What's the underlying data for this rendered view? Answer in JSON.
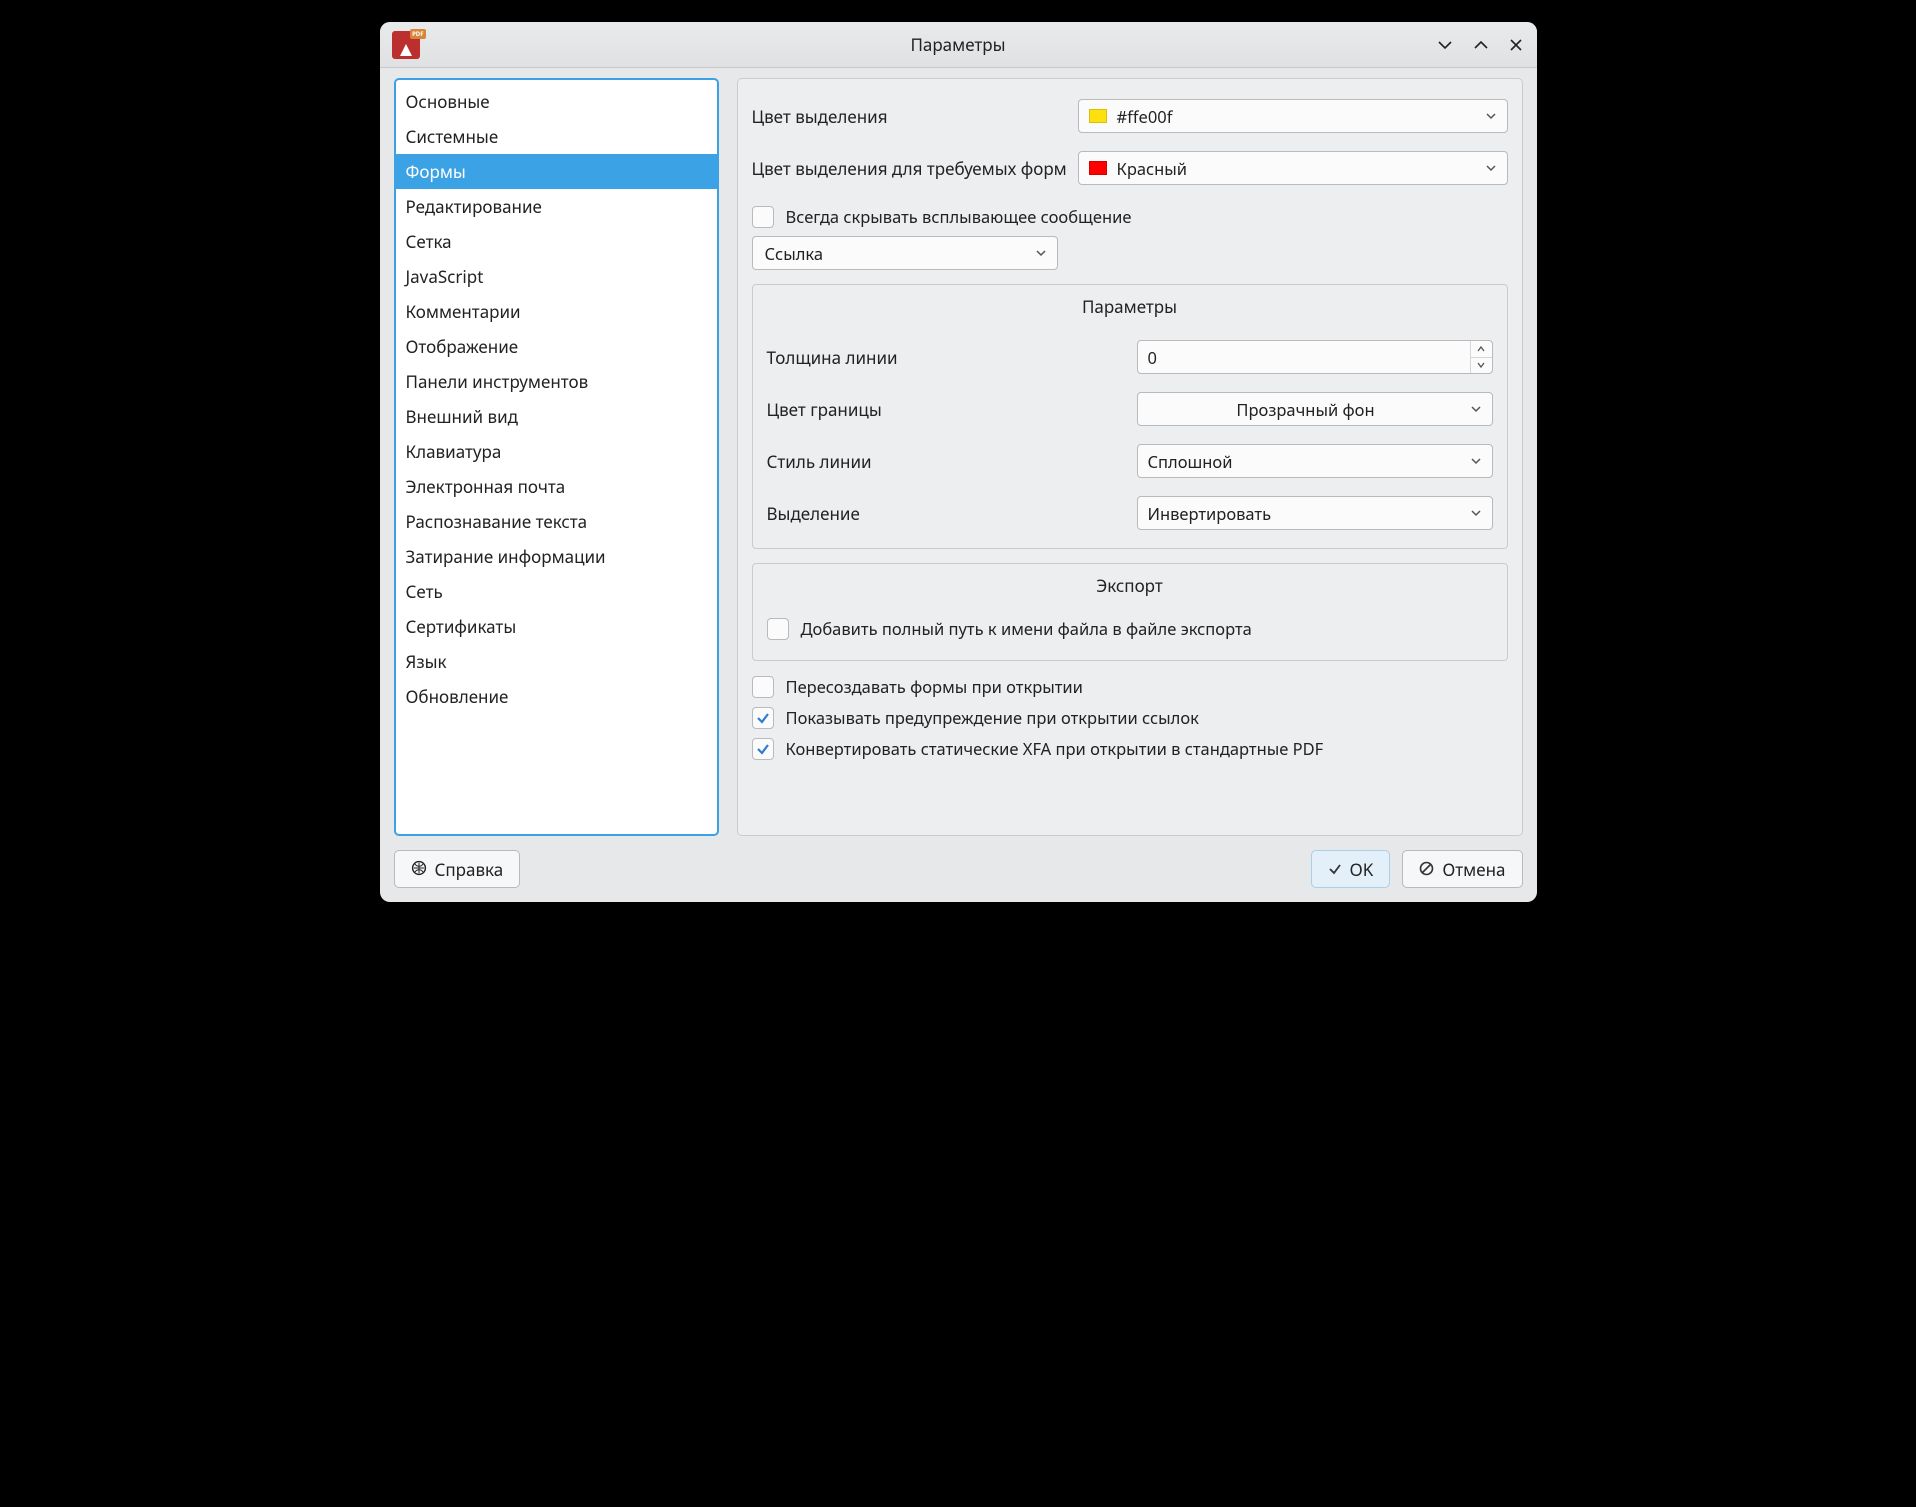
{
  "window": {
    "title": "Параметры"
  },
  "sidebar": {
    "items": [
      "Основные",
      "Системные",
      "Формы",
      "Редактирование",
      "Сетка",
      "JavaScript",
      "Комментарии",
      "Отображение",
      "Панели инструментов",
      "Внешний вид",
      "Клавиатура",
      "Электронная почта",
      "Распознавание текста",
      "Затирание информации",
      "Сеть",
      "Сертификаты",
      "Язык",
      "Обновление"
    ],
    "selected_index": 2
  },
  "form": {
    "highlight_color_label": "Цвет выделения",
    "highlight_color_value": "#ffe00f",
    "highlight_color_swatch": "#ffe00f",
    "required_highlight_label": "Цвет выделения для требуемых форм",
    "required_highlight_value": "Красный",
    "required_highlight_swatch": "#ff0000",
    "always_hide_popup": "Всегда скрывать всплывающее сообщение",
    "link_combo": "Ссылка",
    "params_group_title": "Параметры",
    "line_width_label": "Толщина линии",
    "line_width_value": "0",
    "border_color_label": "Цвет границы",
    "border_color_value": "Прозрачный фон",
    "line_style_label": "Стиль линии",
    "line_style_value": "Сплошной",
    "highlight_mode_label": "Выделение",
    "highlight_mode_value": "Инвертировать",
    "export_group_title": "Экспорт",
    "export_fullpath": "Добавить полный путь к имени файла в файле экспорта",
    "recreate_on_open": "Пересоздавать формы при открытии",
    "warn_on_links": "Показывать предупреждение при открытии ссылок",
    "convert_xfa": "Конвертировать статические XFA при открытии в стандартные PDF"
  },
  "footer": {
    "help": "Справка",
    "ok": "OK",
    "cancel": "Отмена"
  }
}
